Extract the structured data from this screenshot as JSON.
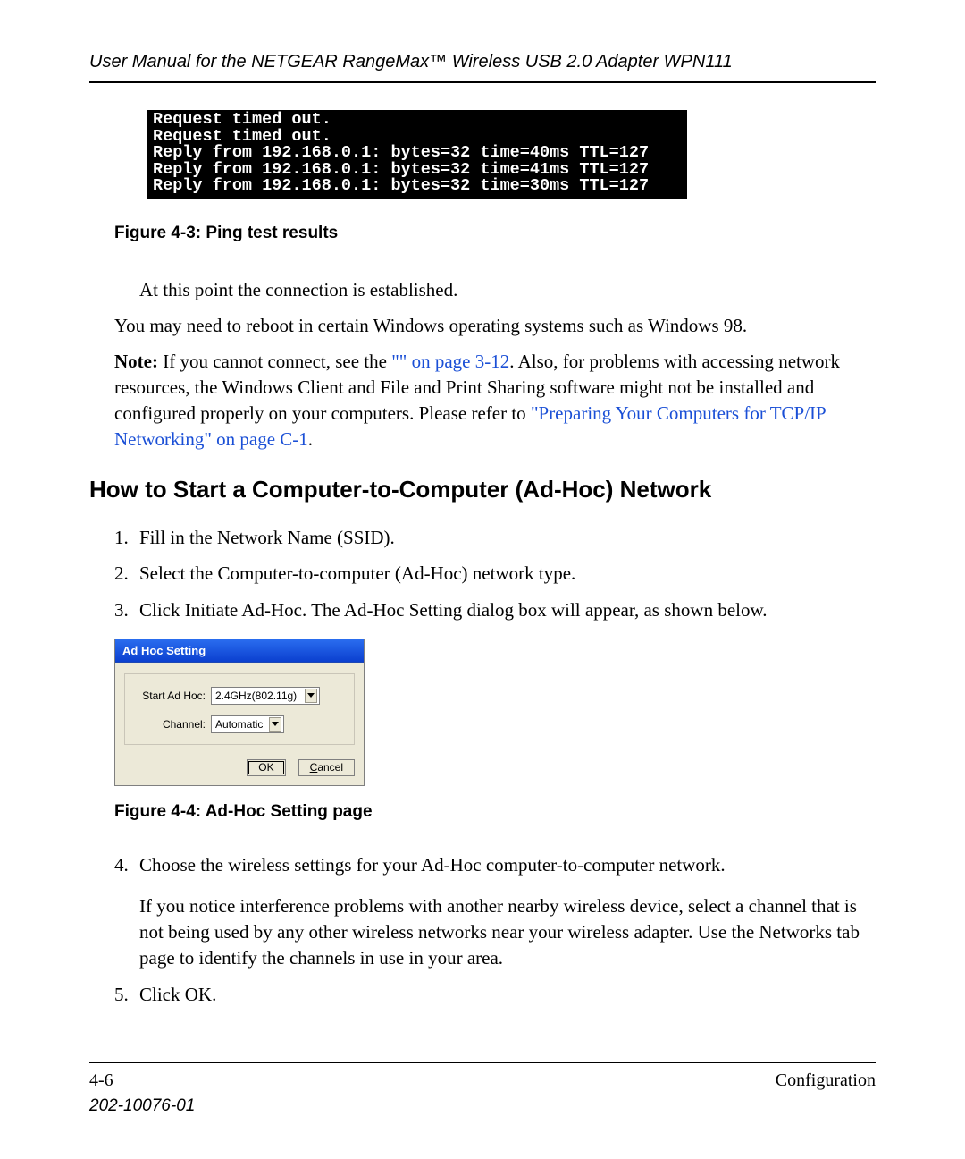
{
  "header": {
    "title": "User Manual for the NETGEAR RangeMax™ Wireless USB 2.0 Adapter WPN111"
  },
  "terminal": {
    "lines": [
      "Request timed out.",
      "Request timed out.",
      "Reply from 192.168.0.1: bytes=32 time=40ms TTL=127",
      "Reply from 192.168.0.1: bytes=32 time=41ms TTL=127",
      "Reply from 192.168.0.1: bytes=32 time=30ms TTL=127"
    ]
  },
  "figure3_caption": "Figure 4-3:  Ping test results",
  "para_established": "At this point the connection is established.",
  "para_reboot": "You may need to reboot in certain Windows operating systems such as Windows 98.",
  "note": {
    "label": "Note:",
    "pre": " If you cannot connect, see the ",
    "link1": "\"\" on page 3-12",
    "mid": ". Also, for problems with accessing network resources, the Windows Client and File and Print Sharing software might not be installed and configured properly on your computers. Please refer to ",
    "link2": "\"Preparing Your Computers for TCP/IP Networking\" on page C-1",
    "post": "."
  },
  "h2": "How to Start a Computer-to-Computer (Ad-Hoc) Network",
  "steps_top": [
    "Fill in the Network Name (SSID).",
    "Select the Computer-to-computer (Ad-Hoc) network type.",
    "Click Initiate Ad-Hoc. The Ad-Hoc Setting dialog box will appear, as shown below."
  ],
  "dialog": {
    "title": "Ad Hoc Setting",
    "start_label": "Start Ad Hoc:",
    "start_value": "2.4GHz(802.11g)",
    "channel_label": "Channel:",
    "channel_value": "Automatic",
    "ok_label": "OK",
    "cancel_prefix": "C",
    "cancel_rest": "ancel"
  },
  "figure4_caption": "Figure 4-4:  Ad-Hoc Setting page",
  "step4": {
    "num": "4.",
    "text": "Choose the wireless settings for your Ad-Hoc computer-to-computer network.",
    "sub": "If you notice interference problems with another nearby wireless device, select a channel that is not being used by any other wireless networks near your wireless adapter. Use the Networks tab page to identify the channels in use in your area."
  },
  "step5": {
    "num": "5.",
    "text": "Click OK."
  },
  "footer": {
    "page_num": "4-6",
    "section": "Configuration",
    "doc_number": "202-10076-01"
  }
}
